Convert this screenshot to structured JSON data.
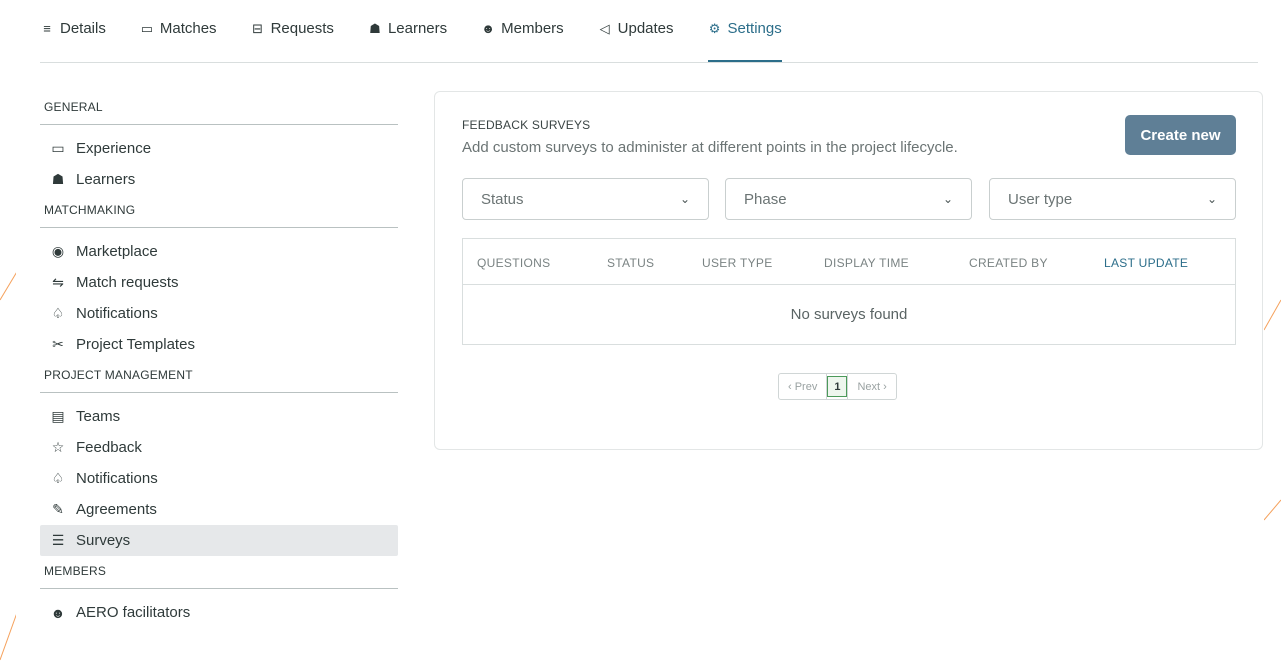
{
  "tabs": [
    {
      "label": "Details",
      "icon": "details-icon",
      "glyph": "≡",
      "active": false
    },
    {
      "label": "Matches",
      "icon": "folder-icon",
      "glyph": "▭",
      "active": false
    },
    {
      "label": "Requests",
      "icon": "inbox-icon",
      "glyph": "⊟",
      "active": false
    },
    {
      "label": "Learners",
      "icon": "graduation-cap-icon",
      "glyph": "☗",
      "active": false
    },
    {
      "label": "Members",
      "icon": "members-icon",
      "glyph": "☻",
      "active": false
    },
    {
      "label": "Updates",
      "icon": "megaphone-icon",
      "glyph": "◁",
      "active": false
    },
    {
      "label": "Settings",
      "icon": "gear-icon",
      "glyph": "⚙",
      "active": true
    }
  ],
  "sidebar": {
    "general": {
      "title": "GENERAL",
      "items": [
        {
          "label": "Experience",
          "glyph": "▭"
        },
        {
          "label": "Learners",
          "glyph": "☗"
        }
      ]
    },
    "matchmaking": {
      "title": "MATCHMAKING",
      "items": [
        {
          "label": "Marketplace",
          "glyph": "◉"
        },
        {
          "label": "Match requests",
          "glyph": "⇋"
        },
        {
          "label": "Notifications",
          "glyph": "♤"
        },
        {
          "label": "Project Templates",
          "glyph": "✂"
        }
      ]
    },
    "project_management": {
      "title": "PROJECT MANAGEMENT",
      "items": [
        {
          "label": "Teams",
          "glyph": "▤"
        },
        {
          "label": "Feedback",
          "glyph": "☆"
        },
        {
          "label": "Notifications",
          "glyph": "♤"
        },
        {
          "label": "Agreements",
          "glyph": "✎"
        },
        {
          "label": "Surveys",
          "glyph": "☰"
        }
      ]
    },
    "members": {
      "title": "MEMBERS",
      "items": [
        {
          "label": "AERO facilitators",
          "glyph": "☻"
        }
      ]
    }
  },
  "card": {
    "label": "FEEDBACK SURVEYS",
    "description": "Add custom surveys to administer at different points in the project lifecycle.",
    "create_label": "Create new",
    "filters": [
      {
        "placeholder": "Status"
      },
      {
        "placeholder": "Phase"
      },
      {
        "placeholder": "User type"
      }
    ],
    "columns": [
      "QUESTIONS",
      "STATUS",
      "USER TYPE",
      "DISPLAY TIME",
      "CREATED BY",
      "LAST UPDATE"
    ],
    "sorted_column": "LAST UPDATE",
    "empty_text": "No surveys found",
    "pagination": {
      "prev": "‹ Prev",
      "current": "1",
      "next": "Next ›"
    }
  },
  "colors": {
    "accent": "#2c6e8a",
    "button": "#5f7f96",
    "active_item_bg": "#e6e8ea",
    "decor_orange": "#f5a15c"
  }
}
